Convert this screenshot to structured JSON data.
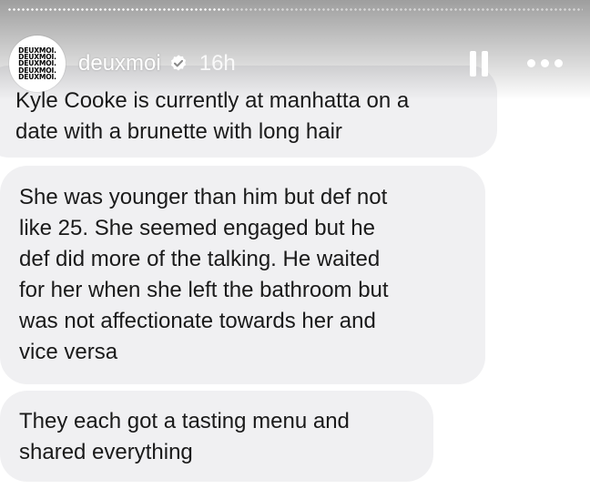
{
  "story": {
    "progress_fraction": 0.37
  },
  "header": {
    "avatar_text": [
      "DEUXMOI.",
      "DEUXMOI.",
      "DEUXMOI.",
      "DEUXMOI.",
      "DEUXMOI."
    ],
    "username": "deuxmoi",
    "verified_icon": "verified-badge-icon",
    "time": "16h",
    "pause_icon": "pause-icon",
    "more_icon": "more-icon"
  },
  "messages": [
    {
      "text": "Kyle Cooke is currently at manhatta on a\ndate with a brunette with long hair"
    },
    {
      "text": "She was younger than him but def not\nlike 25. She seemed engaged but he\ndef did more of the talking. He waited\nfor her when she left the bathroom but\nwas not affectionate towards her and\nvice versa"
    },
    {
      "text": "They each got a tasting menu and\nshared everything"
    }
  ],
  "colors": {
    "bubble_bg": "#f0f0f2",
    "text": "#1a1a1a"
  }
}
